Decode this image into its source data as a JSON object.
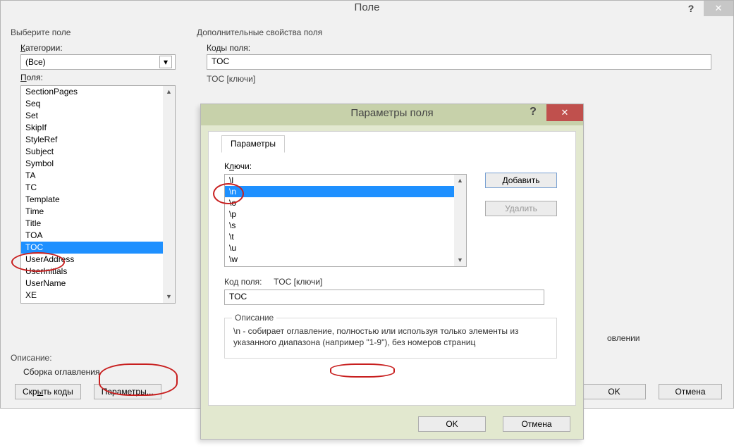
{
  "main": {
    "title": "Поле",
    "left_section": "Выберите поле",
    "right_section": "Дополнительные свойства поля",
    "categories_label": "Категории:",
    "category_value": "(Все)",
    "fields_label": "Поля:",
    "fields": [
      "SectionPages",
      "Seq",
      "Set",
      "SkipIf",
      "StyleRef",
      "Subject",
      "Symbol",
      "TA",
      "TC",
      "Template",
      "Time",
      "Title",
      "TOA",
      "TOC",
      "UserAddress",
      "UserInitials",
      "UserName",
      "XE"
    ],
    "selected_field": "TOC",
    "description_label": "Описание:",
    "description_text": "Сборка оглавления",
    "btn_hide_codes": "Скрыть коды",
    "btn_options": "Параметры...",
    "codes_label": "Коды поля:",
    "codes_value": "TOC",
    "usage_hint": "TOC [ключи]",
    "right_extra": "овлении",
    "btn_ok": "OK",
    "btn_cancel": "Отмена"
  },
  "sub": {
    "title": "Параметры поля",
    "tab_label": "Параметры",
    "switches_label": "Ключи:",
    "switches": [
      "\\l",
      "\\n",
      "\\o",
      "\\p",
      "\\s",
      "\\t",
      "\\u",
      "\\w"
    ],
    "selected_switch": "\\n",
    "btn_add": "Добавить",
    "btn_remove": "Удалить",
    "code_prefix": "Код поля:",
    "code_hint": "TOC [ключи]",
    "code_value": "TOC",
    "desc_legend": "Описание",
    "desc_text": "\\n - собирает оглавление, полностью или используя только элементы из указанного диапазона (например \"1-9\"), без номеров страниц",
    "btn_ok": "OK",
    "btn_cancel": "Отмена"
  },
  "icons": {
    "close": "✕",
    "help": "?",
    "chev_down": "▾",
    "tri_up": "▲",
    "tri_down": "▼"
  }
}
